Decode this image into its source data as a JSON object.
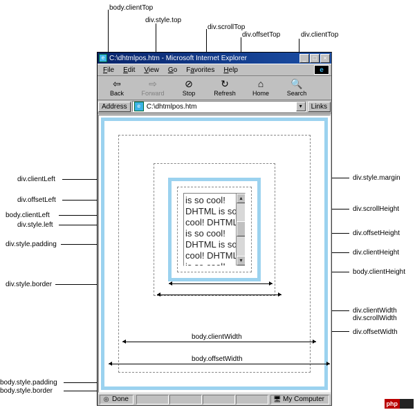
{
  "window": {
    "title": "C:\\dhtmlpos.htm - Microsoft Internet Explorer",
    "btn_min": "_",
    "btn_max": "□",
    "btn_close": "×"
  },
  "menubar": {
    "file": "File",
    "edit": "Edit",
    "view": "View",
    "go": "Go",
    "favorites": "Favorites",
    "help": "Help"
  },
  "toolbar": {
    "back": {
      "label": "Back",
      "icon": "⇦"
    },
    "forward": {
      "label": "Forward",
      "icon": "⇨"
    },
    "stop": {
      "label": "Stop",
      "icon": "⊘"
    },
    "refresh": {
      "label": "Refresh",
      "icon": "↻"
    },
    "home": {
      "label": "Home",
      "icon": "⌂"
    },
    "search": {
      "label": "Search",
      "icon": "🔍"
    }
  },
  "addressbar": {
    "label": "Address",
    "value": "C:\\dhtmlpos.htm",
    "links": "Links"
  },
  "statusbar": {
    "done": "Done",
    "zone": "My Computer"
  },
  "content": {
    "text": "is so cool! DHTML is so cool! DHTML is so cool! DHTML is so cool! DHTML is so cool! DHTML is"
  },
  "labels": {
    "top": {
      "body_clientTop": "body.clientTop",
      "div_style_top": "div.style.top",
      "div_scrollTop": "div.scrollTop",
      "div_offsetTop": "div.offsetTop",
      "div_clientTop": "div.clientTop"
    },
    "left": {
      "div_clientLeft": "div.clientLeft",
      "div_offsetLeft": "div.offsetLeft",
      "body_clientLeft": "body.clientLeft",
      "div_style_left": "div.style.left",
      "div_style_padding": "div.style.padding",
      "div_style_border": "div.style.border",
      "body_style_padding": "body.style.padding",
      "body_style_border": "body.style.border"
    },
    "right": {
      "div_style_margin": "div.style.margin",
      "div_scrollHeight": "div.scrollHeight",
      "div_offsetHeight": "div.offsetHeight",
      "div_clientHeight": "div.clientHeight",
      "body_clientHeight": "body.clientHeight",
      "div_clientWidth": "div.clientWidth",
      "div_scrollWidth": "div.scrollWidth",
      "div_offsetWidth": "div.offsetWidth"
    },
    "inside": {
      "body_clientWidth": "body.clientWidth",
      "body_offsetWidth": "body.offsetWidth"
    }
  },
  "watermark": {
    "a": "php",
    "b": ""
  }
}
